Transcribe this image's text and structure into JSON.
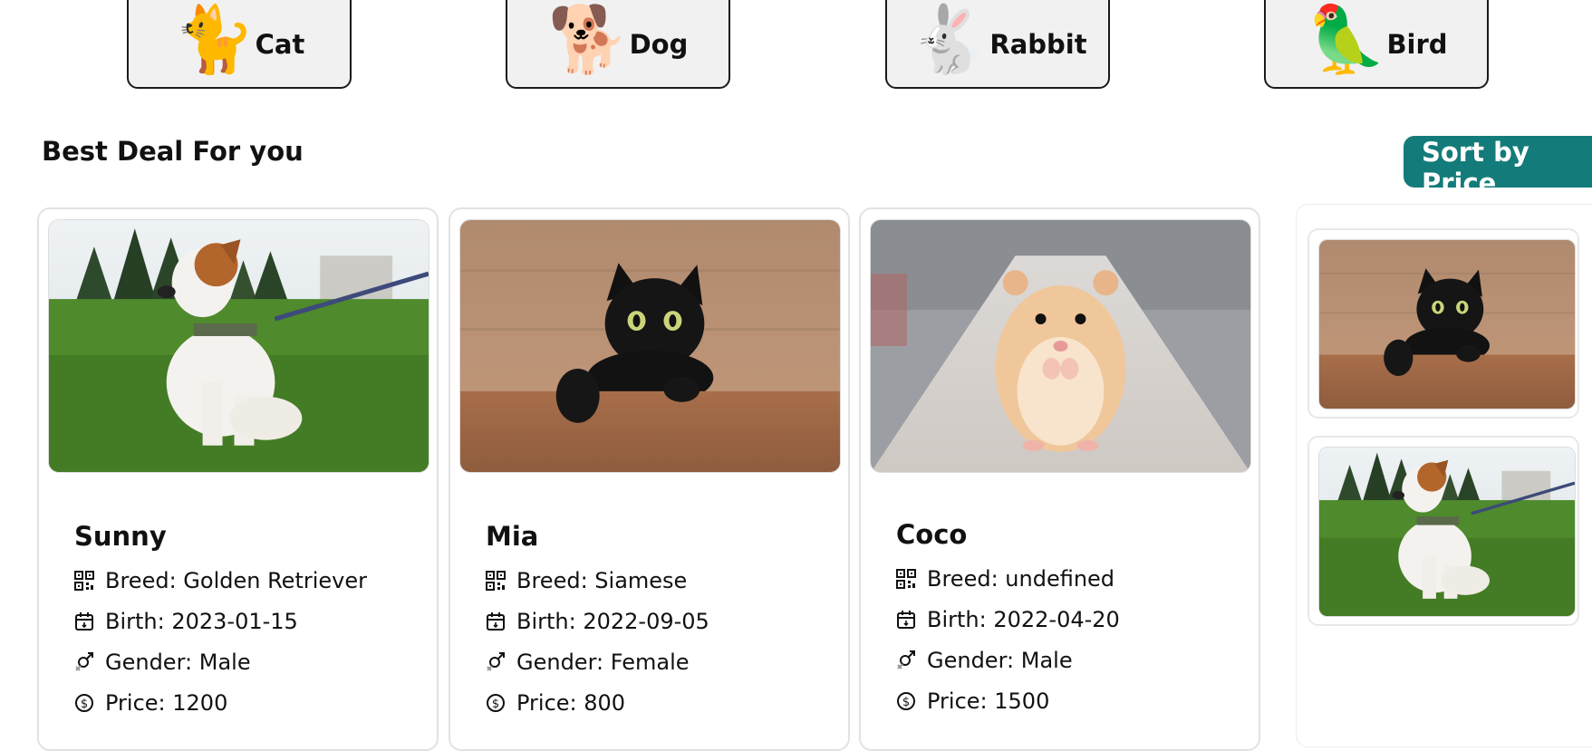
{
  "categories": [
    {
      "label": "Cat",
      "emoji": "🐈",
      "icon": "cat-icon"
    },
    {
      "label": "Dog",
      "emoji": "🐕",
      "icon": "dog-icon"
    },
    {
      "label": "Rabbit",
      "emoji": "🐇",
      "icon": "rabbit-icon"
    },
    {
      "label": "Bird",
      "emoji": "🦜",
      "icon": "parrot-icon"
    }
  ],
  "section": {
    "title": "Best Deal For you"
  },
  "sort": {
    "label": "Sort by Price"
  },
  "pets": [
    {
      "name": "Sunny",
      "image": "dog-photo",
      "breed": "Breed: Golden Retriever",
      "birth": "Birth: 2023-01-15",
      "gender": "Gender: Male",
      "price": "Price: 1200"
    },
    {
      "name": "Mia",
      "image": "cat-photo",
      "breed": "Breed: Siamese",
      "birth": "Birth: 2022-09-05",
      "gender": "Gender: Female",
      "price": "Price: 800"
    },
    {
      "name": "Coco",
      "image": "hamster-photo",
      "breed": "Breed: undefined",
      "birth": "Birth: 2022-04-20",
      "gender": "Gender: Male",
      "price": "Price: 1500"
    }
  ],
  "side_list": [
    {
      "image": "cat-photo"
    },
    {
      "image": "dog-photo"
    }
  ],
  "colors": {
    "accent": "#137c7a",
    "button_bg": "#f1f1f1",
    "card_border": "#e2e2e2"
  }
}
